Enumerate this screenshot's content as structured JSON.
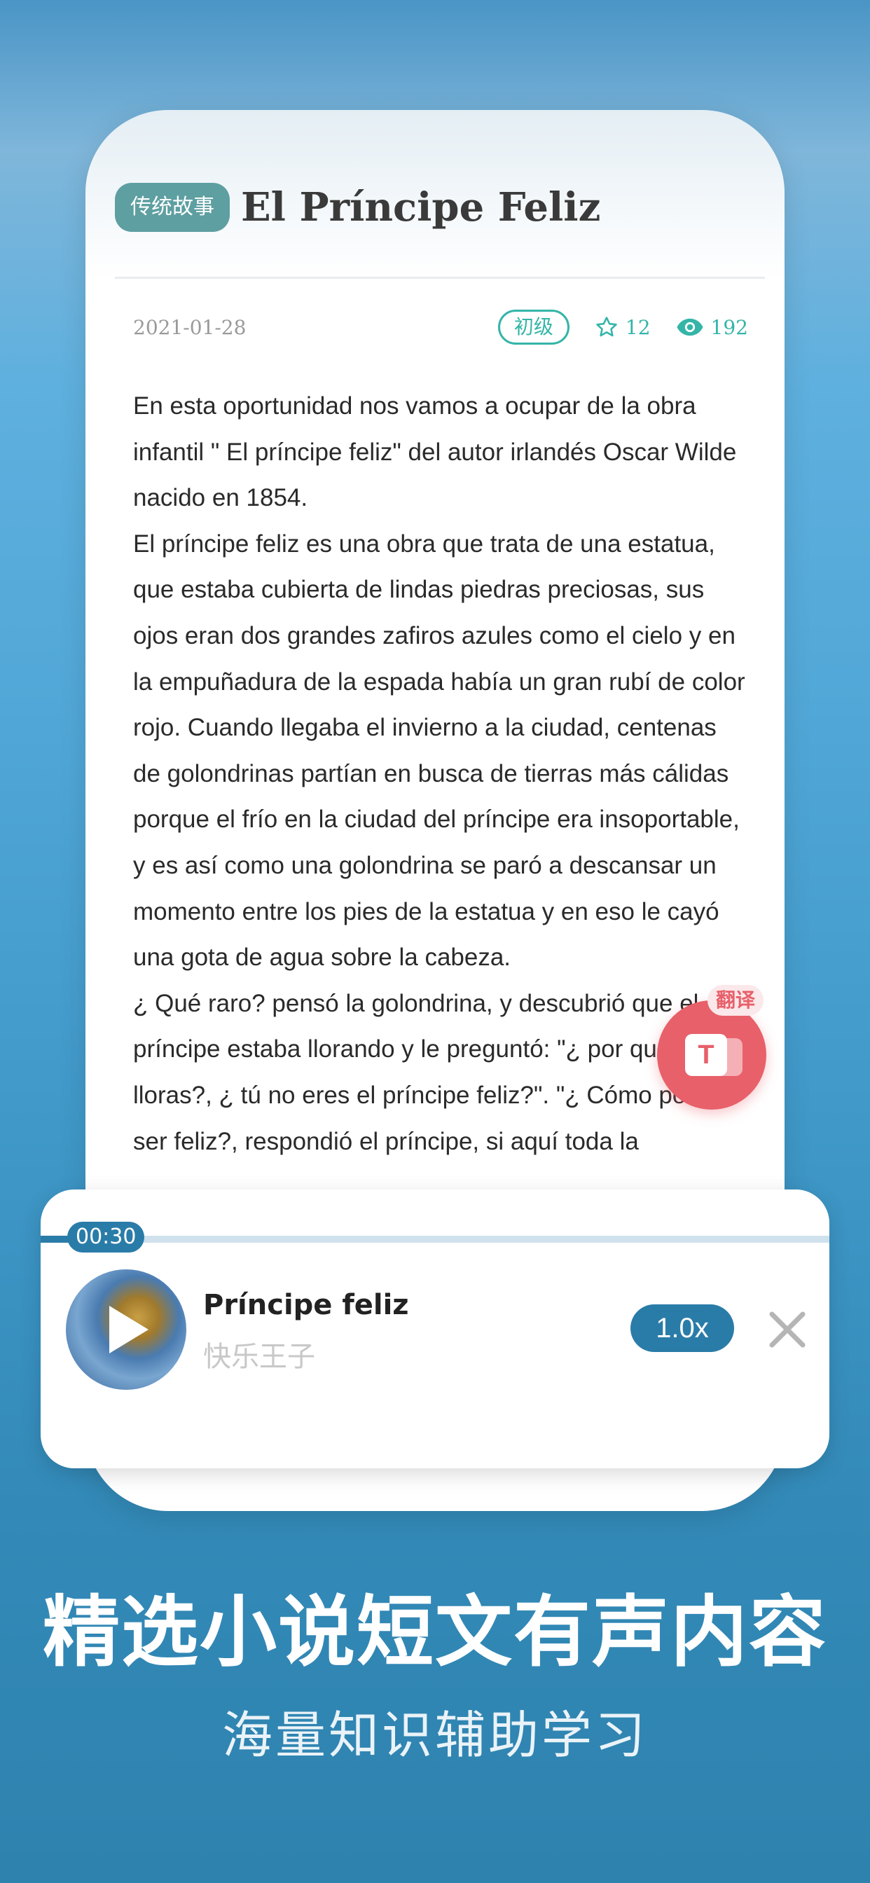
{
  "article": {
    "tag": "传统故事",
    "title": "El Príncipe Feliz",
    "date": "2021-01-28",
    "level": "初级",
    "favorites": "12",
    "views": "192",
    "paragraphs": [
      "En esta oportunidad nos vamos a ocupar de la obra infantil \" El príncipe feliz\" del autor irlandés Oscar Wilde nacido en 1854.",
      "El príncipe feliz es una obra que trata de una estatua, que estaba cubierta de lindas piedras preciosas, sus ojos eran dos grandes zafiros azules como el cielo y en la empuñadura de la espada había un gran rubí de color rojo. Cuando llegaba el invierno a la ciudad, centenas de golondrinas partían en busca de tierras más cálidas porque el frío en la ciudad del príncipe era insoportable, y es así como una golondrina se paró a descansar un momento entre los pies de la estatua y en eso le cayó una gota de agua sobre la cabeza.",
      "¿ Qué raro? pensó la golondrina, y descubrió que el príncipe estaba llorando y le preguntó: \"¿ por qué lloras?, ¿ tú no eres el príncipe feliz?\". \"¿ Cómo podría ser feliz?, respondió el príncipe, si aquí toda la"
    ]
  },
  "translate": {
    "badge": "翻译",
    "icon_letter": "T"
  },
  "player": {
    "time": "00:30",
    "track_title": "Príncipe feliz",
    "track_subtitle": "快乐王子",
    "speed": "1.0x"
  },
  "promo": {
    "headline": "精选小说短文有声内容",
    "subline": "海量知识辅助学习"
  },
  "colors": {
    "accent_teal": "#34b5a8",
    "tag_bg": "#5e9fa1",
    "translate_red": "#e8606a",
    "player_blue": "#2a7ca8"
  }
}
